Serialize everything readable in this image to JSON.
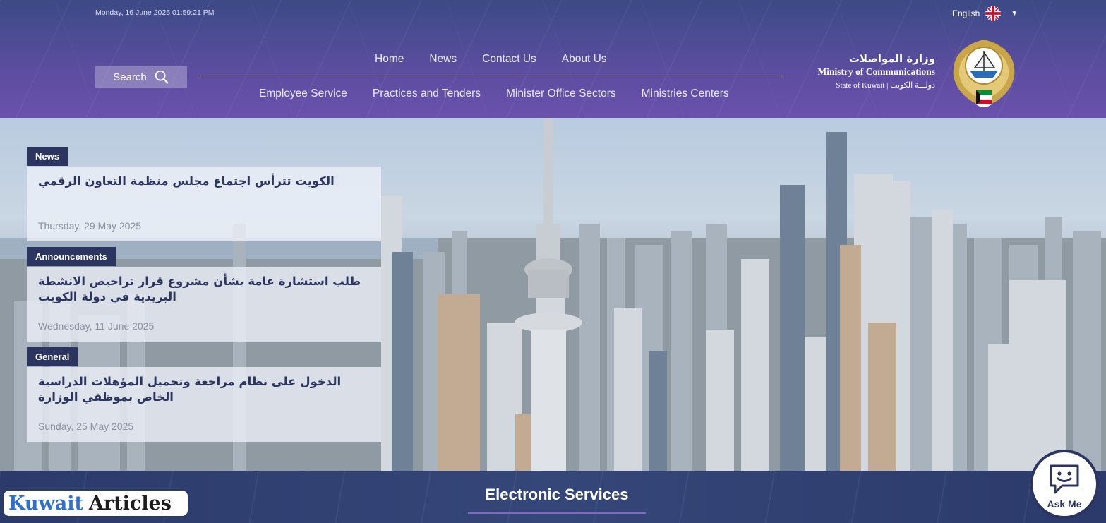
{
  "header": {
    "datetime": "Monday, 16 June 2025 01:59:21 PM",
    "language": "English",
    "search_label": "Search",
    "nav_top": [
      "Home",
      "News",
      "Contact Us",
      "About Us"
    ],
    "nav_bottom": [
      "Employee Service",
      "Practices and Tenders",
      "Minister Office Sectors",
      "Ministries Centers"
    ],
    "brand": {
      "name_ar": "وزارة المواصلات",
      "name_en": "Ministry of Communications",
      "state": "State of Kuwait | دولـــة الكويت"
    }
  },
  "cards": [
    {
      "tag": "News",
      "title": "الكويت تترأس اجتماع مجلس منظمة التعاون الرقمي",
      "date": "Thursday, 29 May 2025"
    },
    {
      "tag": "Announcements",
      "title": "طلب استشارة عامة بشأن مشروع قرار تراخيص الانشطة البريدية في دولة الكويت",
      "date": "Wednesday, 11 June 2025"
    },
    {
      "tag": "General",
      "title": "الدخول على نظام مراجعة وتحميل المؤهلات الدراسية الخاص بموظفي الوزارة",
      "date": "Sunday, 25 May 2025"
    }
  ],
  "services": {
    "title": "Electronic Services"
  },
  "watermark": {
    "part1": "Kuwait",
    "part2": "Articles"
  },
  "chat": {
    "label": "Ask Me"
  },
  "colors": {
    "header_top": "#3b4a86",
    "header_bottom": "#6a51ad",
    "navy": "#2b3560",
    "accent": "#7f6ac3"
  }
}
